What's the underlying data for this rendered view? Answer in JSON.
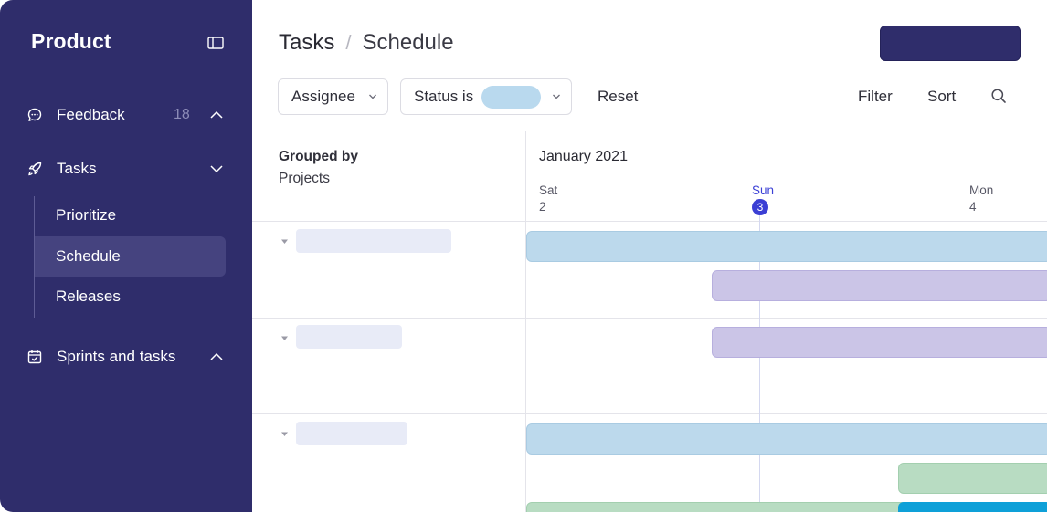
{
  "sidebar": {
    "title": "Product",
    "nav": [
      {
        "label": "Feedback",
        "count": "18",
        "icon": "chat-bubble-icon",
        "expanded": false
      },
      {
        "label": "Tasks",
        "icon": "rocket-icon",
        "expanded": true
      },
      {
        "label": "Sprints and tasks",
        "icon": "calendar-check-icon",
        "expanded": false
      }
    ],
    "tasks_children": [
      "Prioritize",
      "Schedule",
      "Releases"
    ],
    "active_child": "Schedule"
  },
  "header": {
    "breadcrumb": [
      "Tasks",
      "Schedule"
    ],
    "separator": "/"
  },
  "toolbar": {
    "assignee_label": "Assignee",
    "status_label": "Status is",
    "reset_label": "Reset",
    "filter_label": "Filter",
    "sort_label": "Sort"
  },
  "timeline": {
    "grouped_by_label": "Grouped by",
    "grouped_by_value": "Projects",
    "month": "January 2021",
    "days": [
      {
        "name": "Sat",
        "num": "2",
        "today": false
      },
      {
        "name": "Sun",
        "num": "3",
        "today": true
      },
      {
        "name": "Mon",
        "num": "4",
        "today": false
      }
    ]
  },
  "colors": {
    "sidebar_bg": "#2f2d6b",
    "accent": "#3b3fd4",
    "bar_blue": "#bcd9ec",
    "bar_purple": "#cbc5e7",
    "bar_green": "#b8dcc2",
    "bar_cyan": "#0ea0d8"
  }
}
